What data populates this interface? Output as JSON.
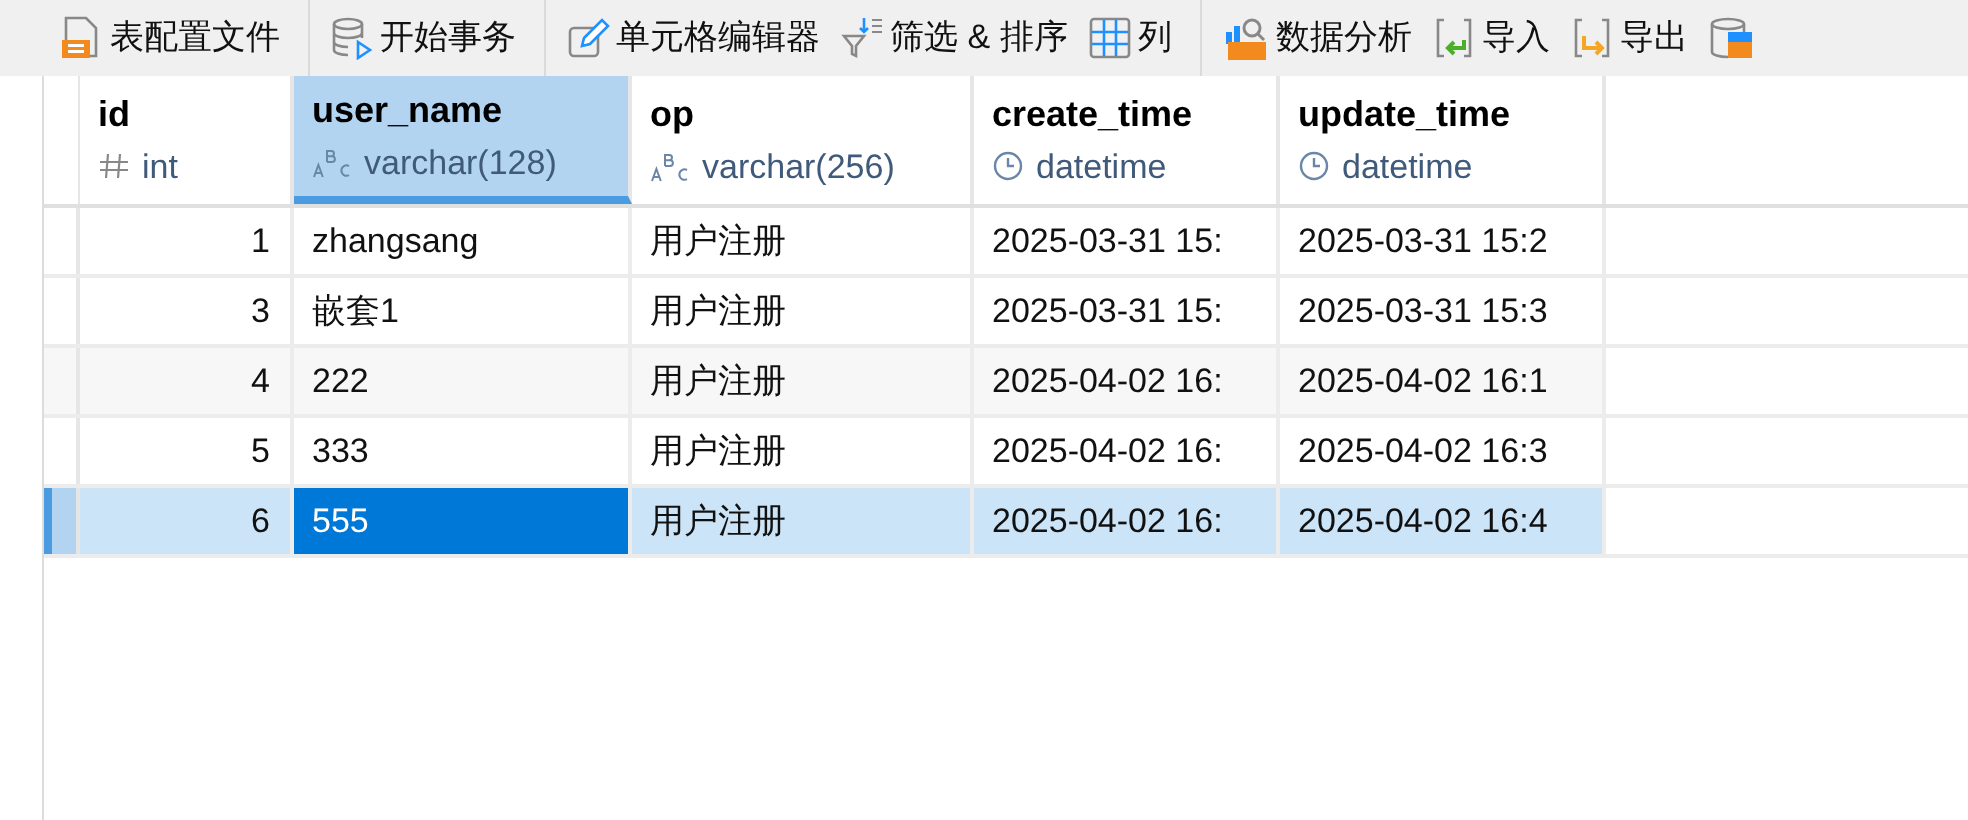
{
  "toolbar": [
    [
      {
        "label": "表配置文件"
      }
    ],
    [
      {
        "label": "开始事务"
      }
    ],
    [
      {
        "label": "单元格编辑器"
      },
      {
        "label": "筛选 & 排序"
      },
      {
        "label": "列"
      }
    ],
    [
      {
        "label": "数据分析"
      },
      {
        "label": "导入"
      },
      {
        "label": "导出"
      }
    ]
  ],
  "table": {
    "columns": [
      {
        "name": "id",
        "type": "int",
        "kind": "number",
        "selected": false
      },
      {
        "name": "user_name",
        "type": "varchar(128)",
        "kind": "text",
        "selected": true
      },
      {
        "name": "op",
        "type": "varchar(256)",
        "kind": "text",
        "selected": false
      },
      {
        "name": "create_time",
        "type": "datetime",
        "kind": "time",
        "selected": false
      },
      {
        "name": "update_time",
        "type": "datetime",
        "kind": "time",
        "selected": false
      }
    ],
    "rows": [
      {
        "selected": false,
        "cells": [
          {
            "text": "1",
            "selected": false
          },
          {
            "text": "zhangsang",
            "selected": false
          },
          {
            "text": "用户注册",
            "selected": false
          },
          {
            "text": "2025-03-31 15:",
            "selected": false
          },
          {
            "text": "2025-03-31 15:2",
            "selected": false
          }
        ]
      },
      {
        "selected": false,
        "cells": [
          {
            "text": "3",
            "selected": false
          },
          {
            "text": "嵌套1",
            "selected": false
          },
          {
            "text": "用户注册",
            "selected": false
          },
          {
            "text": "2025-03-31 15:",
            "selected": false
          },
          {
            "text": "2025-03-31 15:3",
            "selected": false
          }
        ]
      },
      {
        "selected": false,
        "hovered": true,
        "cells": [
          {
            "text": "4",
            "selected": false
          },
          {
            "text": "222",
            "selected": false
          },
          {
            "text": "用户注册",
            "selected": false
          },
          {
            "text": "2025-04-02 16:",
            "selected": false
          },
          {
            "text": "2025-04-02 16:1",
            "selected": false
          }
        ]
      },
      {
        "selected": false,
        "cells": [
          {
            "text": "5",
            "selected": false
          },
          {
            "text": "333",
            "selected": false
          },
          {
            "text": "用户注册",
            "selected": false
          },
          {
            "text": "2025-04-02 16:",
            "selected": false
          },
          {
            "text": "2025-04-02 16:3",
            "selected": false
          }
        ]
      },
      {
        "selected": true,
        "cells": [
          {
            "text": "6",
            "selected": false
          },
          {
            "text": "555",
            "selected": true
          },
          {
            "text": "用户注册",
            "selected": false
          },
          {
            "text": "2025-04-02 16:",
            "selected": false
          },
          {
            "text": "2025-04-02 16:4",
            "selected": false
          }
        ]
      }
    ]
  }
}
